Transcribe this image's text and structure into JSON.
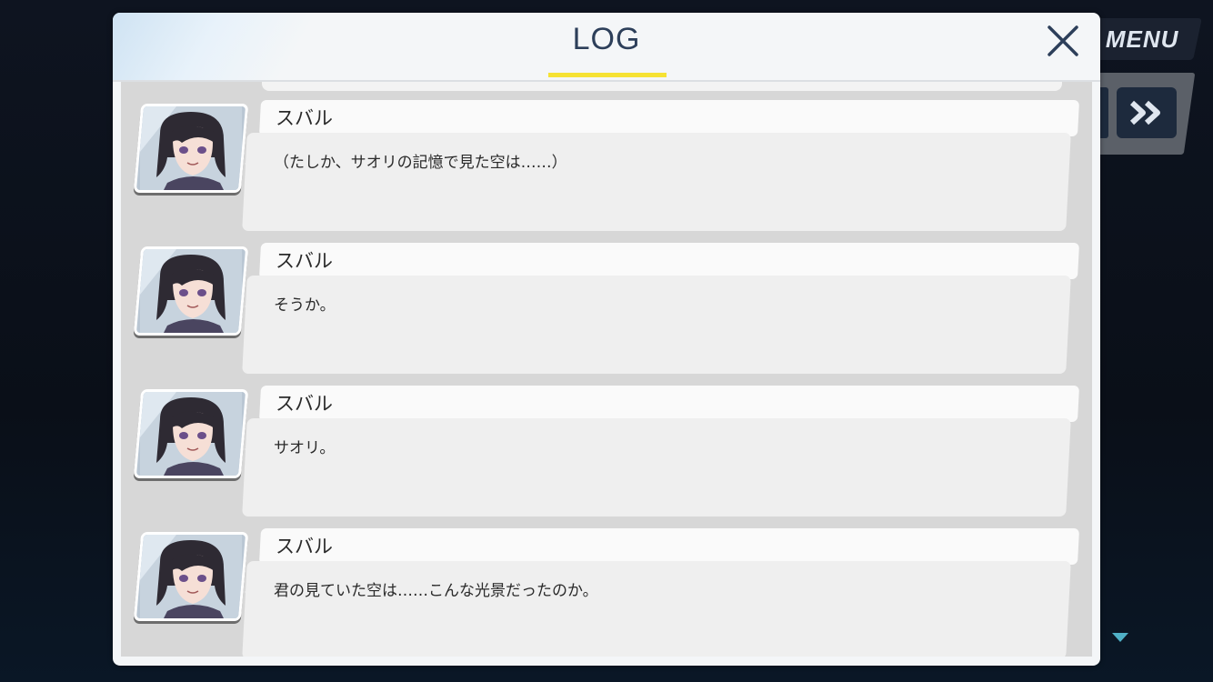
{
  "hud": {
    "menu_label": "MENU"
  },
  "panel": {
    "title": "LOG"
  },
  "entries": [
    {
      "speaker": "スバル",
      "text": "（たしか、サオリの記憶で見た空は……）"
    },
    {
      "speaker": "スバル",
      "text": "そうか。"
    },
    {
      "speaker": "スバル",
      "text": "サオリ。"
    },
    {
      "speaker": "スバル",
      "text": "君の見ていた空は……こんな光景だったのか。"
    }
  ],
  "icons": {
    "close": "close-icon",
    "fast_forward": "fast-forward-icon",
    "scroll_down": "triangle-down-icon",
    "avatar": "character-portrait"
  },
  "colors": {
    "title": "#2d3f5a",
    "underline": "#f6e234",
    "panel_bg": "#f4f6f8",
    "log_bg": "#d7d7d7"
  }
}
